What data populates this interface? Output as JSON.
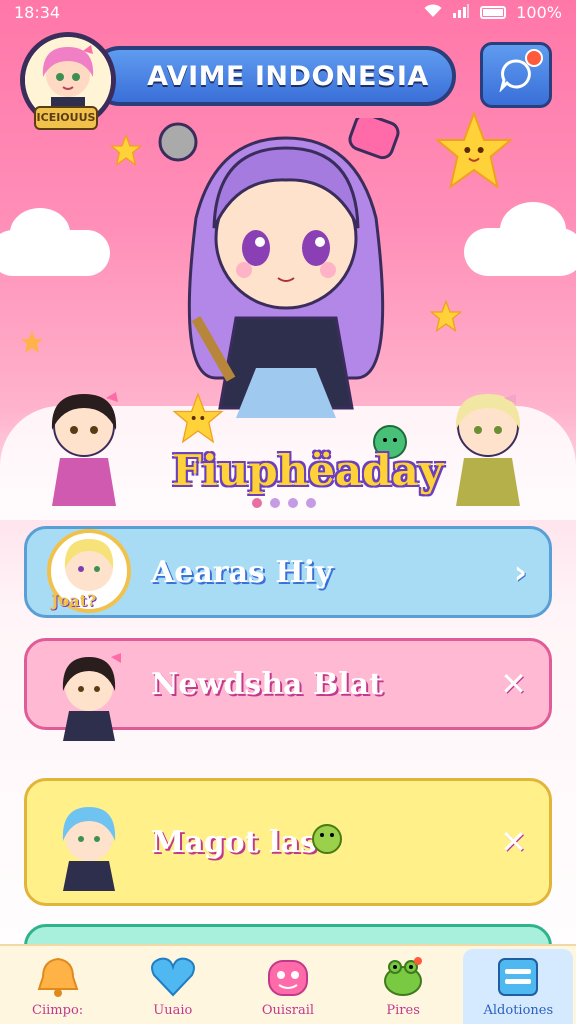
{
  "status_bar": {
    "time": "18:34",
    "battery": "100%"
  },
  "header": {
    "title": "AVIME INDONESIA",
    "avatar_badge": "ICEIOUUS"
  },
  "hero": {
    "title": "Fiuphëaday",
    "carousel": {
      "count": 4,
      "active": 0
    }
  },
  "cards": [
    {
      "label": "Aearas Hiy",
      "action_icon": "chevron-right-icon",
      "action": "›",
      "badge": "Joat?",
      "bg": "#a8dcf5",
      "border": "#5a9fd4",
      "text": "#ffffff"
    },
    {
      "label": "Newdsha Blat",
      "action_icon": "close-icon",
      "action": "✕",
      "bg": "#ffb9d2",
      "border": "#e05c97",
      "text": "#ffffff"
    },
    {
      "label": "Magot las",
      "action_icon": "close-icon",
      "action": "✕",
      "bg": "#fff08a",
      "border": "#e0b53a",
      "text": "#ffffff"
    }
  ],
  "nav": [
    {
      "label": "Ciimpo:",
      "icon": "bell-icon"
    },
    {
      "label": "Uuaio",
      "icon": "heart-icon"
    },
    {
      "label": "Ouisrail",
      "icon": "monster-icon"
    },
    {
      "label": "Pires",
      "icon": "frog-icon"
    },
    {
      "label": "Aldotiones",
      "icon": "menu-icon",
      "selected": true
    }
  ],
  "colors": {
    "accent": "#3a6fd8",
    "pink": "#ff77a8"
  }
}
